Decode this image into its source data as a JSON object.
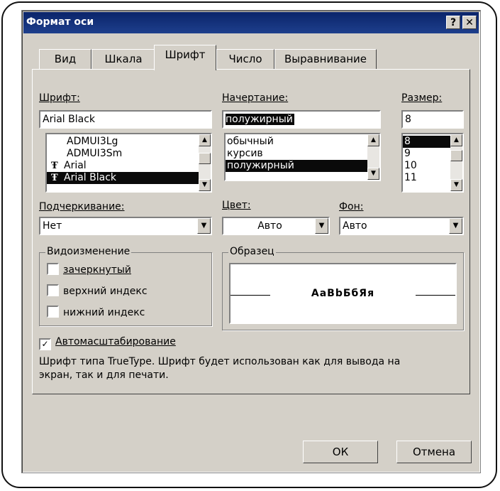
{
  "window": {
    "title": "Формат оси",
    "help_label": "?",
    "close_label": "✕"
  },
  "tabs": [
    "Вид",
    "Шкала",
    "Шрифт",
    "Число",
    "Выравнивание"
  ],
  "active_tab": "Шрифт",
  "font": {
    "label": "Шрифт:",
    "value": "Arial Black",
    "list": [
      "ADMUI3Lg",
      "ADMUI3Sm",
      "Arial",
      "Arial Black"
    ],
    "selected": "Arial Black"
  },
  "style": {
    "label": "Начертание:",
    "value": "полужирный",
    "list": [
      "обычный",
      "курсив",
      "полужирный"
    ],
    "selected": "полужирный"
  },
  "size": {
    "label": "Размер:",
    "value": "8",
    "list": [
      "8",
      "9",
      "10",
      "11"
    ],
    "selected": "8"
  },
  "underline": {
    "label": "Подчеркивание:",
    "value": "Нет"
  },
  "color": {
    "label": "Цвет:",
    "value": "Авто"
  },
  "background": {
    "label": "Фон:",
    "value": "Авто"
  },
  "effects": {
    "title": "Видоизменение",
    "strikethrough": "зачеркнутый",
    "superscript": "верхний индекс",
    "subscript": "нижний индекс"
  },
  "sample": {
    "title": "Образец",
    "text": "АаВbБбЯя"
  },
  "autoscale": {
    "label": "Автомасштабирование",
    "checked": true
  },
  "info_text": "Шрифт типа TrueType. Шрифт будет использован как для вывода на экран, так и для печати.",
  "buttons": {
    "ok": "ОК",
    "cancel": "Отмена"
  },
  "icons": {
    "truetype": "TT-font-icon",
    "dropdown": "chevron-down-icon",
    "scroll_up": "scroll-up-icon",
    "scroll_down": "scroll-down-icon",
    "check": "checkmark-icon"
  }
}
